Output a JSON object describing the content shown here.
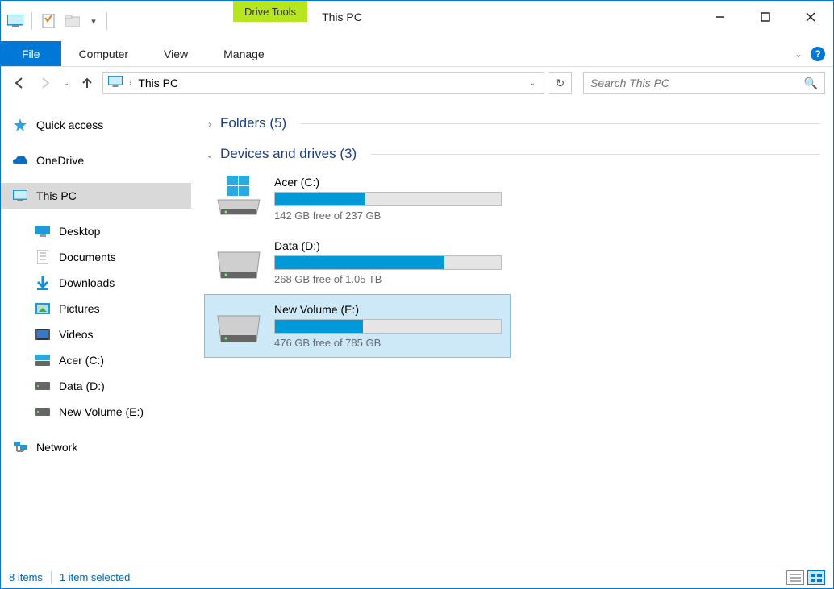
{
  "window": {
    "title": "This PC"
  },
  "ribbon": {
    "drive_tools_label": "Drive Tools",
    "tabs": {
      "file": "File",
      "computer": "Computer",
      "view": "View",
      "manage": "Manage"
    }
  },
  "address": {
    "location": "This PC"
  },
  "search": {
    "placeholder": "Search This PC"
  },
  "navpane": {
    "quick_access": "Quick access",
    "onedrive": "OneDrive",
    "this_pc": "This PC",
    "children": {
      "desktop": "Desktop",
      "documents": "Documents",
      "downloads": "Downloads",
      "pictures": "Pictures",
      "videos": "Videos",
      "acer": "Acer (C:)",
      "data": "Data (D:)",
      "newvol": "New Volume (E:)"
    },
    "network": "Network"
  },
  "groups": {
    "folders": {
      "label": "Folders (5)"
    },
    "devices": {
      "label": "Devices and drives (3)"
    }
  },
  "drives": {
    "c": {
      "name": "Acer (C:)",
      "free": "142 GB free of 237 GB",
      "fill_pct": 40
    },
    "d": {
      "name": "Data (D:)",
      "free": "268 GB free of 1.05 TB",
      "fill_pct": 75
    },
    "e": {
      "name": "New Volume (E:)",
      "free": "476 GB free of 785 GB",
      "fill_pct": 39
    }
  },
  "status": {
    "items": "8 items",
    "selected": "1 item selected"
  }
}
